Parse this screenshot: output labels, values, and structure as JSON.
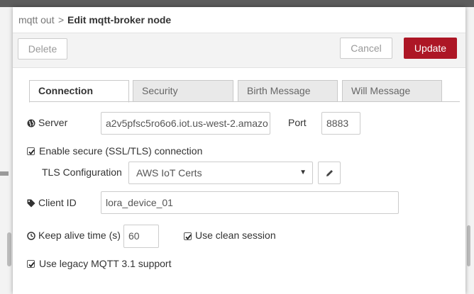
{
  "breadcrumb": {
    "previous": "mqtt out",
    "separator": ">",
    "title": "Edit mqtt-broker node"
  },
  "toolbar": {
    "delete_label": "Delete",
    "cancel_label": "Cancel",
    "update_label": "Update"
  },
  "tabs": [
    {
      "label": "Connection",
      "active": true
    },
    {
      "label": "Security",
      "active": false
    },
    {
      "label": "Birth Message",
      "active": false
    },
    {
      "label": "Will Message",
      "active": false
    }
  ],
  "form": {
    "server": {
      "label": "Server",
      "icon": "globe-icon",
      "value": "a2v5pfsc5ro6o6.iot.us-west-2.amazo"
    },
    "port": {
      "label": "Port",
      "value": "8883"
    },
    "tls_enable": {
      "label": "Enable secure (SSL/TLS) connection",
      "checked": true
    },
    "tls_config": {
      "label": "TLS Configuration",
      "value": "AWS IoT Certs",
      "edit_icon": "pencil-icon"
    },
    "client_id": {
      "label": "Client ID",
      "icon": "tag-icon",
      "value": "lora_device_01"
    },
    "keep_alive": {
      "label": "Keep alive time (s)",
      "icon": "clock-icon",
      "value": "60"
    },
    "clean_session": {
      "label": "Use clean session",
      "checked": true
    },
    "legacy_mqtt": {
      "label": "Use legacy MQTT 3.1 support",
      "checked": true
    }
  },
  "colors": {
    "accent": "#ad1625",
    "toolbar_bg": "#f3f3f3",
    "tab_inactive_bg": "#e9e9e9"
  }
}
